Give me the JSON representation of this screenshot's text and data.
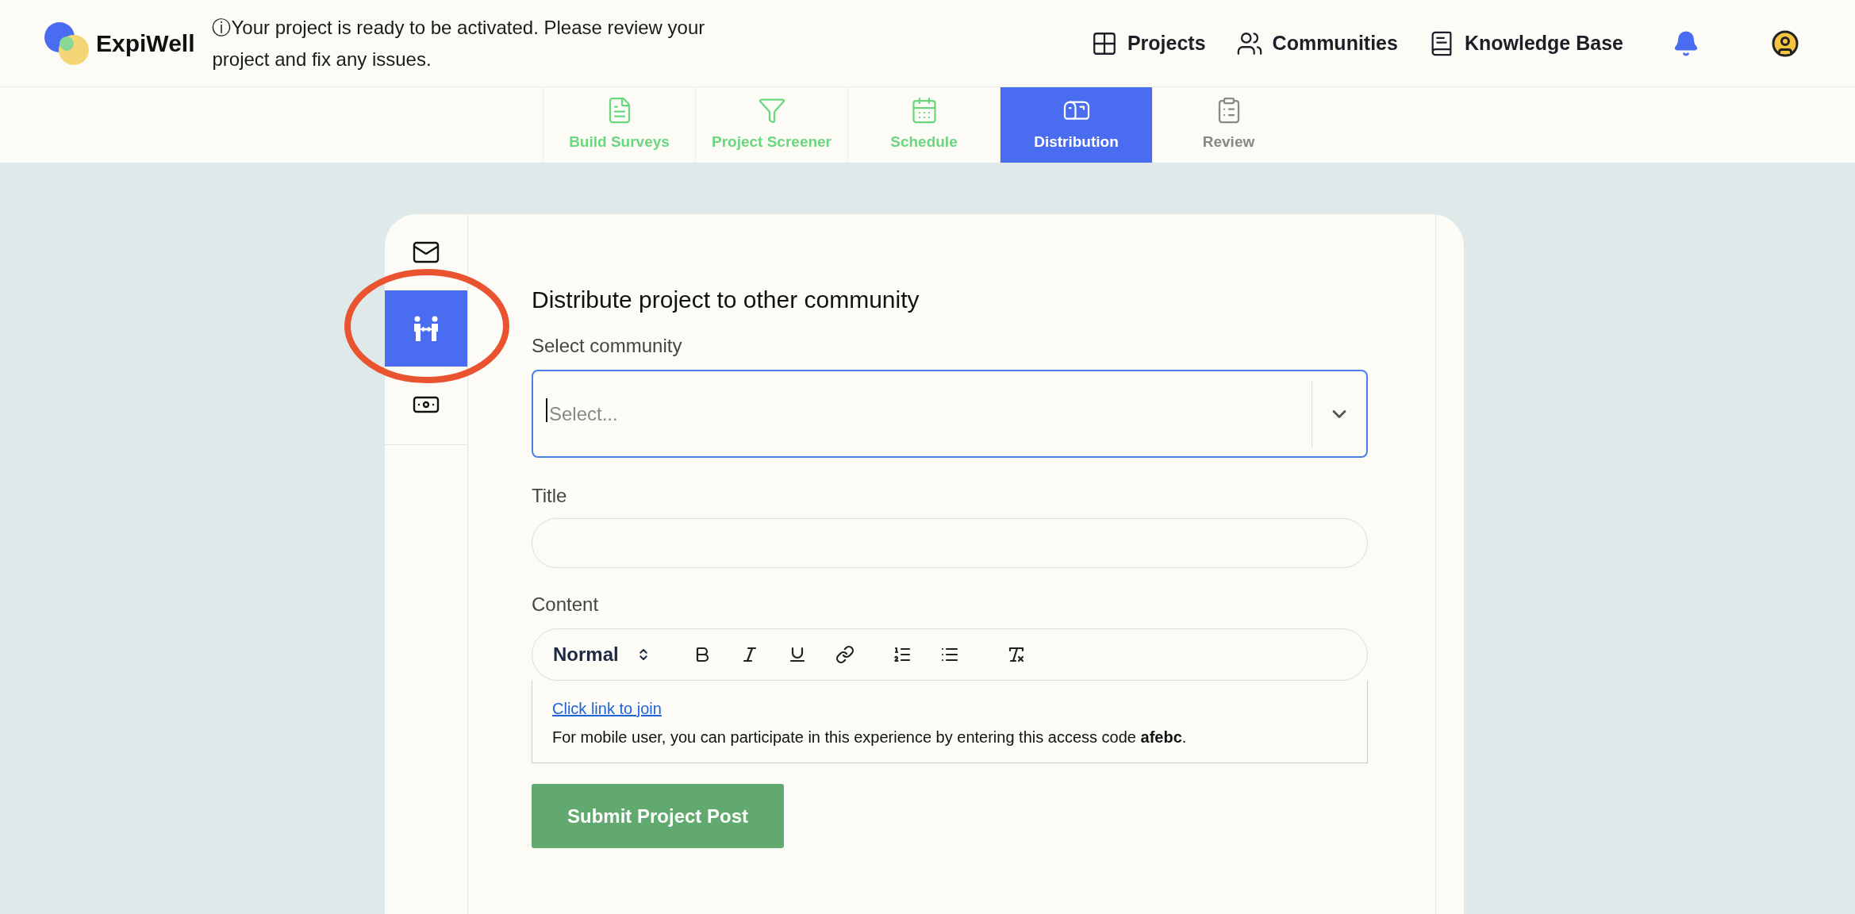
{
  "header": {
    "brand": "ExpiWell",
    "notice": "ⓘYour project is ready to be activated. Please review your project and fix any issues.",
    "nav": [
      {
        "label": "Projects"
      },
      {
        "label": "Communities"
      },
      {
        "label": "Knowledge Base"
      }
    ]
  },
  "tabs": [
    {
      "label": "Build Surveys",
      "completed": true,
      "selected": false
    },
    {
      "label": "Project Screener",
      "completed": true,
      "selected": false
    },
    {
      "label": "Schedule",
      "completed": true,
      "selected": false
    },
    {
      "label": "Distribution",
      "completed": false,
      "selected": true
    },
    {
      "label": "Review",
      "completed": false,
      "selected": false
    }
  ],
  "sidebar": {
    "items": [
      {
        "selected": false
      },
      {
        "selected": true
      },
      {
        "selected": false
      }
    ]
  },
  "form": {
    "heading": "Distribute project to other community",
    "community_label": "Select community",
    "community_placeholder": "Select...",
    "title_label": "Title",
    "content_label": "Content",
    "format": "Normal",
    "link": "Click link to join",
    "body": "For mobile user, you can participate in this experience by entering this access code **afebc**.",
    "submit": "Submit Project Post"
  }
}
